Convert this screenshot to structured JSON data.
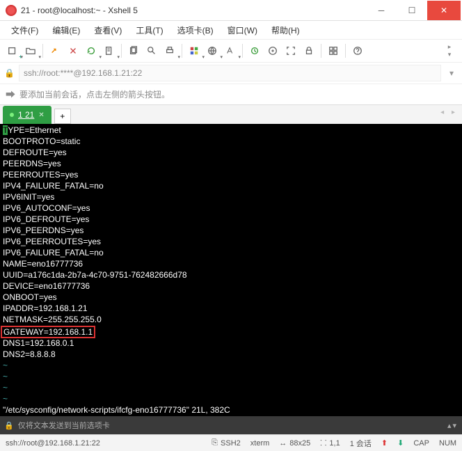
{
  "window": {
    "title": "21 - root@localhost:~ - Xshell 5"
  },
  "menus": {
    "file": "文件(F)",
    "edit": "编辑(E)",
    "view": "查看(V)",
    "tools": "工具(T)",
    "options": "选项卡(B)",
    "window": "窗口(W)",
    "help": "帮助(H)"
  },
  "addressbar": {
    "url": "ssh://root:****@192.168.1.21:22"
  },
  "hint": {
    "text": "要添加当前会话，点击左侧的箭头按钮。"
  },
  "tabs": {
    "active": "1 21",
    "add": "+"
  },
  "terminal": {
    "lines": [
      "TYPE=Ethernet",
      "BOOTPROTO=static",
      "DEFROUTE=yes",
      "PEERDNS=yes",
      "PEERROUTES=yes",
      "IPV4_FAILURE_FATAL=no",
      "IPV6INIT=yes",
      "IPV6_AUTOCONF=yes",
      "IPV6_DEFROUTE=yes",
      "IPV6_PEERDNS=yes",
      "IPV6_PEERROUTES=yes",
      "IPV6_FAILURE_FATAL=no",
      "NAME=eno16777736",
      "UUID=a176c1da-2b7a-4c70-9751-762482666d78",
      "DEVICE=eno16777736",
      "ONBOOT=yes",
      "IPADDR=192.168.1.21",
      "NETMASK=255.255.255.0"
    ],
    "highlighted": "GATEWAY=192.168.1.1",
    "after": [
      "DNS1=192.168.0.1",
      "DNS2=8.8.8.8"
    ],
    "tildes": [
      "~",
      "~",
      "~",
      "~"
    ],
    "footer": "\"/etc/sysconfig/network-scripts/ifcfg-eno16777736\" 21L, 382C"
  },
  "sendbar": {
    "text": "仅将文本发送到当前选项卡"
  },
  "status": {
    "conn": "ssh://root@192.168.1.21:22",
    "proto": "SSH2",
    "term": "xterm",
    "size": "88x25",
    "pos": "1,1",
    "sessions_label": "1 会话",
    "cap": "CAP",
    "num": "NUM"
  }
}
